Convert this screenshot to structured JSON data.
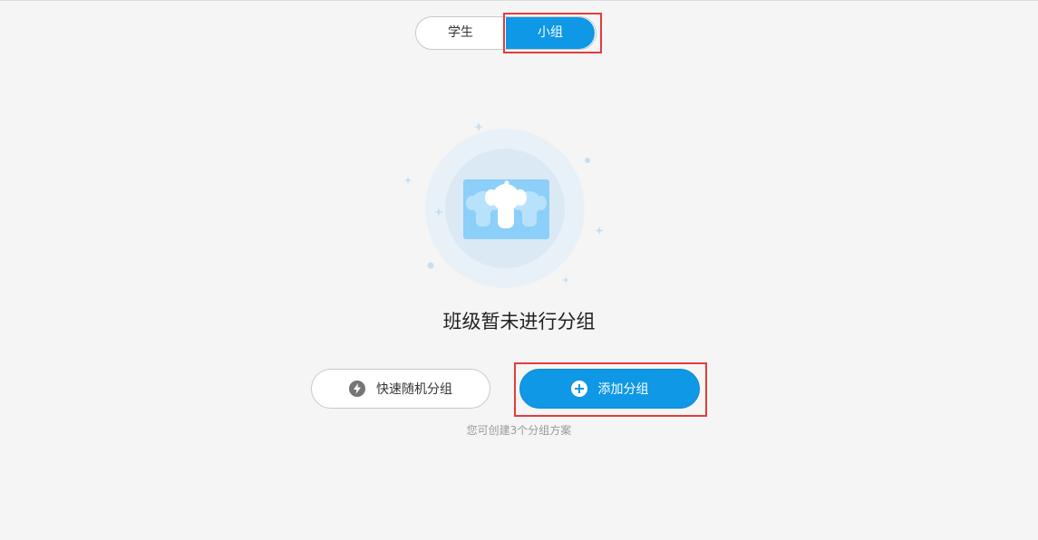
{
  "tabs": [
    {
      "label": "学生",
      "active": false
    },
    {
      "label": "小组",
      "active": true
    }
  ],
  "empty_state": {
    "title": "班级暂未进行分组",
    "illustration": "group-figures-illustration"
  },
  "actions": {
    "random_group_label": "快速随机分组",
    "random_group_icon": "lightning-icon",
    "add_group_label": "添加分组",
    "add_group_icon": "plus-circle-icon"
  },
  "hint": "您可创建3个分组方案",
  "colors": {
    "accent": "#0e98e6",
    "highlight": "#e23c3c",
    "background": "#f5f5f5"
  }
}
